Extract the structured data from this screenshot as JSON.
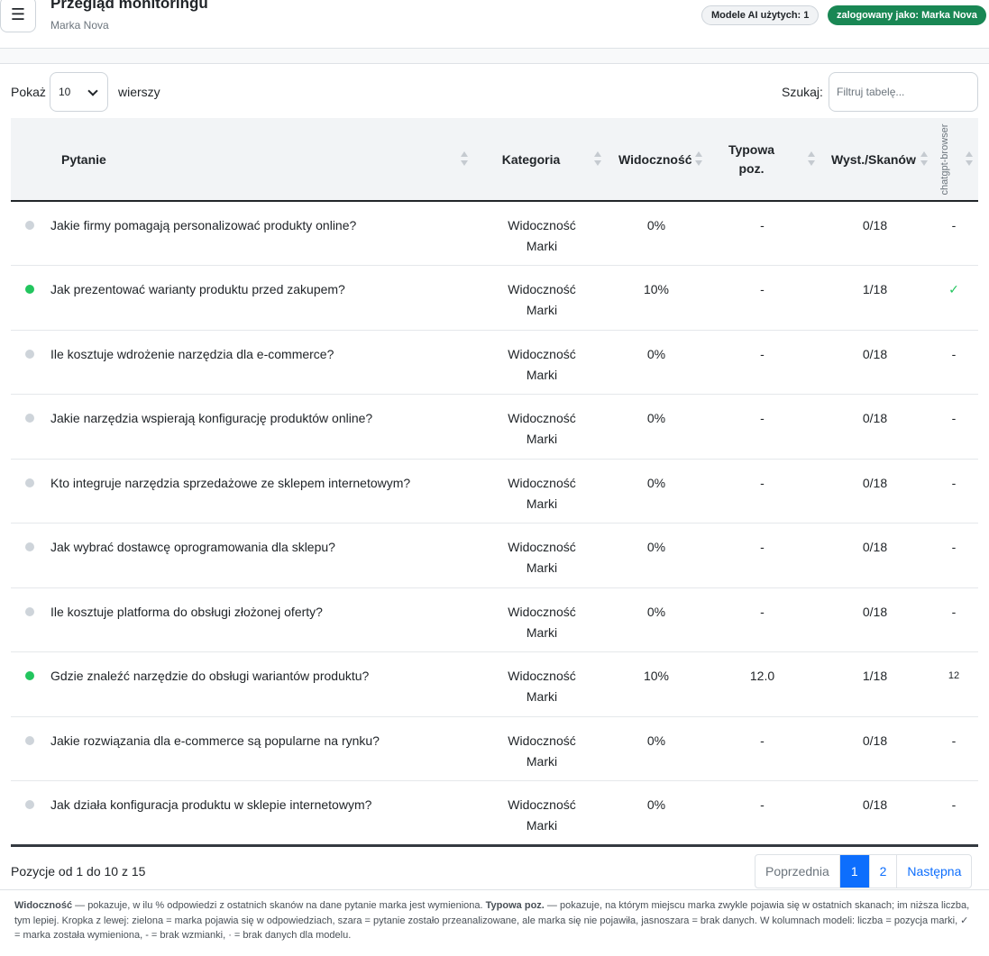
{
  "header": {
    "title": "Przegląd monitoringu",
    "subtitle": "Marka Nova",
    "models_badge": "Modele AI użytych: 1",
    "user_badge": "zalogowany jako: Marka Nova"
  },
  "controls": {
    "show_label": "Pokaż",
    "page_length": "10",
    "rows_label": "wierszy",
    "search_label": "Szukaj:",
    "search_placeholder": "Filtruj tabelę...",
    "search_value": ""
  },
  "table": {
    "columns": {
      "question": "Pytanie",
      "category": "Kategoria",
      "visibility": "Widoczność",
      "typical_pos_line1": "Typowa",
      "typical_pos_line2": "poz.",
      "mentions": "Wyst./Skanów",
      "model": "chatgpt-browser"
    },
    "rows": [
      {
        "status": "gray",
        "question": "Jakie firmy pomagają personalizować produkty online?",
        "category_line1": "Widoczność",
        "category_line2": "Marki",
        "visibility": "0%",
        "typical_pos": "-",
        "mentions": "0/18",
        "model": "-"
      },
      {
        "status": "green",
        "question": "Jak prezentować warianty produktu przed zakupem?",
        "category_line1": "Widoczność",
        "category_line2": "Marki",
        "visibility": "10%",
        "typical_pos": "-",
        "mentions": "1/18",
        "model": "✓"
      },
      {
        "status": "gray",
        "question": "Ile kosztuje wdrożenie narzędzia dla e-commerce?",
        "category_line1": "Widoczność",
        "category_line2": "Marki",
        "visibility": "0%",
        "typical_pos": "-",
        "mentions": "0/18",
        "model": "-"
      },
      {
        "status": "gray",
        "question": "Jakie narzędzia wspierają konfigurację produktów online?",
        "category_line1": "Widoczność",
        "category_line2": "Marki",
        "visibility": "0%",
        "typical_pos": "-",
        "mentions": "0/18",
        "model": "-"
      },
      {
        "status": "gray",
        "question": "Kto integruje narzędzia sprzedażowe ze sklepem internetowym?",
        "category_line1": "Widoczność",
        "category_line2": "Marki",
        "visibility": "0%",
        "typical_pos": "-",
        "mentions": "0/18",
        "model": "-"
      },
      {
        "status": "gray",
        "question": "Jak wybrać dostawcę oprogramowania dla sklepu?",
        "category_line1": "Widoczność",
        "category_line2": "Marki",
        "visibility": "0%",
        "typical_pos": "-",
        "mentions": "0/18",
        "model": "-"
      },
      {
        "status": "gray",
        "question": "Ile kosztuje platforma do obsługi złożonej oferty?",
        "category_line1": "Widoczność",
        "category_line2": "Marki",
        "visibility": "0%",
        "typical_pos": "-",
        "mentions": "0/18",
        "model": "-"
      },
      {
        "status": "green",
        "question": "Gdzie znaleźć narzędzie do obsługi wariantów produktu?",
        "category_line1": "Widoczność",
        "category_line2": "Marki",
        "visibility": "10%",
        "typical_pos": "12.0",
        "mentions": "1/18",
        "model": "12"
      },
      {
        "status": "gray",
        "question": "Jakie rozwiązania dla e-commerce są popularne na rynku?",
        "category_line1": "Widoczność",
        "category_line2": "Marki",
        "visibility": "0%",
        "typical_pos": "-",
        "mentions": "0/18",
        "model": "-"
      },
      {
        "status": "gray",
        "question": "Jak działa konfiguracja produktu w sklepie internetowym?",
        "category_line1": "Widoczność",
        "category_line2": "Marki",
        "visibility": "0%",
        "typical_pos": "-",
        "mentions": "0/18",
        "model": "-"
      }
    ]
  },
  "pagination": {
    "info": "Pozycje od 1 do 10 z 15",
    "prev": "Poprzednia",
    "page1": "1",
    "page2": "2",
    "next": "Następna"
  },
  "footnote": {
    "term1": "Widoczność",
    "text1": " — pokazuje, w ilu % odpowiedzi z ostatnich skanów na dane pytanie marka jest wymieniona. ",
    "term2": "Typowa poz.",
    "text2": " — pokazuje, na którym miejscu marka zwykle pojawia się w ostatnich skanach; im niższa liczba, tym lepiej. Kropka z lewej: zielona = marka pojawia się w odpowiedziach, szara = pytanie zostało przeanalizowane, ale marka się nie pojawiła, jasnoszara = brak danych. W kolumnach modeli: liczba = pozycja marki, ✓ = marka została wymieniona, - = brak wzmianki, · = brak danych dla modelu."
  },
  "colors": {
    "dot_green": "#22c55e",
    "dot_gray": "#ced4da",
    "accent": "#0d6efd",
    "user_badge": "#198754",
    "visibility_text": "#c62828",
    "check": "#22c55e"
  }
}
